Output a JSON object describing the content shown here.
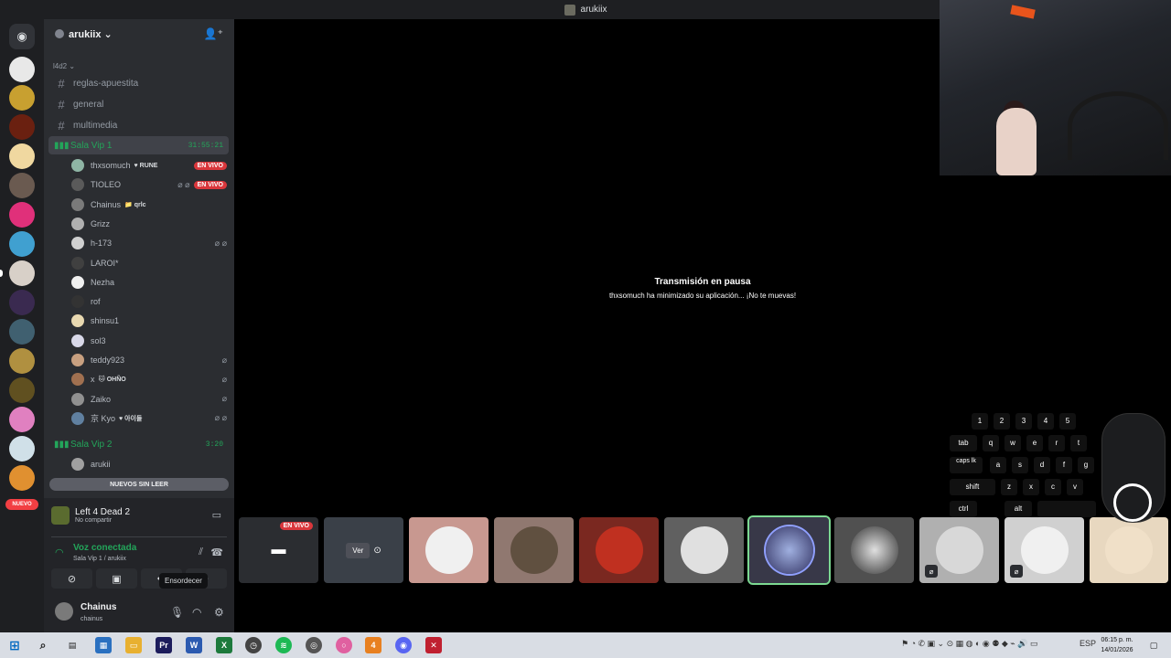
{
  "window": {
    "title": "arukiix"
  },
  "server": {
    "name": "arukiix ⌄"
  },
  "sidebar": {
    "category": "l4d2 ⌄",
    "text_channels": [
      "reglas-apuestita",
      "general",
      "multimedia"
    ],
    "voice_channel_1": {
      "name": "Sala Vip 1",
      "timer": "31:55:21"
    },
    "voice_users": [
      {
        "name": "thxsomuch",
        "badge": "♥ RUNE",
        "live": "EN VIVO",
        "color": "#8fb5a5"
      },
      {
        "name": "TIOLEO",
        "badge": "",
        "live": "EN VIVO",
        "icons": "⌀ ⌀",
        "color": "#5a5a5a"
      },
      {
        "name": "Chainus",
        "badge": "📁 qrlc",
        "color": "#7a7a7a"
      },
      {
        "name": "Grizz",
        "badge": "",
        "color": "#b0b0b0"
      },
      {
        "name": "h-173",
        "badge": "",
        "icons": "⌀ ⌀",
        "color": "#d0d0d0"
      },
      {
        "name": "LAROI*",
        "badge": "",
        "color": "#404040"
      },
      {
        "name": "Nezha",
        "badge": "",
        "color": "#f0f0f0"
      },
      {
        "name": "rof",
        "badge": "",
        "color": "#333333"
      },
      {
        "name": "shinsu1",
        "badge": "",
        "color": "#e8d8b0"
      },
      {
        "name": "sol3",
        "badge": "",
        "color": "#d8d8e8"
      },
      {
        "name": "teddy923",
        "badge": "",
        "icons": "⌀",
        "color": "#c8a080"
      },
      {
        "name": "x",
        "badge": "🐱 OHÑO",
        "icons": "⌀",
        "color": "#a07050"
      },
      {
        "name": "Zaiko",
        "badge": "",
        "icons": "⌀",
        "color": "#909090"
      },
      {
        "name": "京 Kyo",
        "badge": "♥ 아이들",
        "icons": "⌀ ⌀",
        "color": "#6080a0"
      }
    ],
    "voice_channel_2": {
      "name": "Sala Vip 2",
      "timer": "3:20"
    },
    "voice_channel_2_users": [
      {
        "name": "arukii",
        "color": "#a0a0a0"
      }
    ],
    "new_unread": "NUEVOS SIN LEER"
  },
  "panel": {
    "game_title": "Left 4 Dead 2",
    "game_sub": "No compartir",
    "voice_title": "Voz conectada",
    "voice_sub": "Sala Vip 1 / arukiix",
    "tooltip": "Ensordecer",
    "user_name": "Chainus",
    "user_tag": "chainus"
  },
  "guild_badge": "NUEVO",
  "stream": {
    "pause_title": "Transmisión en pausa",
    "pause_sub": "thxsomuch ha minimizado su aplicación... ¡No te muevas!"
  },
  "tiles": {
    "live_label": "EN VIVO",
    "ver_label": "Ver"
  },
  "keyboard": {
    "numbers": [
      "1",
      "2",
      "3",
      "4",
      "5"
    ],
    "row1": [
      "tab",
      "q",
      "w",
      "e",
      "r",
      "t"
    ],
    "row2": [
      "caps lk",
      "a",
      "s",
      "d",
      "f",
      "g"
    ],
    "row3": [
      "shift",
      "z",
      "x",
      "c",
      "v"
    ],
    "row4": [
      "ctrl",
      "alt"
    ]
  },
  "taskbar": {
    "lang": "ESP",
    "time": "06:15 p. m.",
    "date": "14/01/2026"
  },
  "colors": {
    "accent_green": "#23a55a",
    "live_red": "#da373c",
    "sidebar": "#2b2d31"
  }
}
